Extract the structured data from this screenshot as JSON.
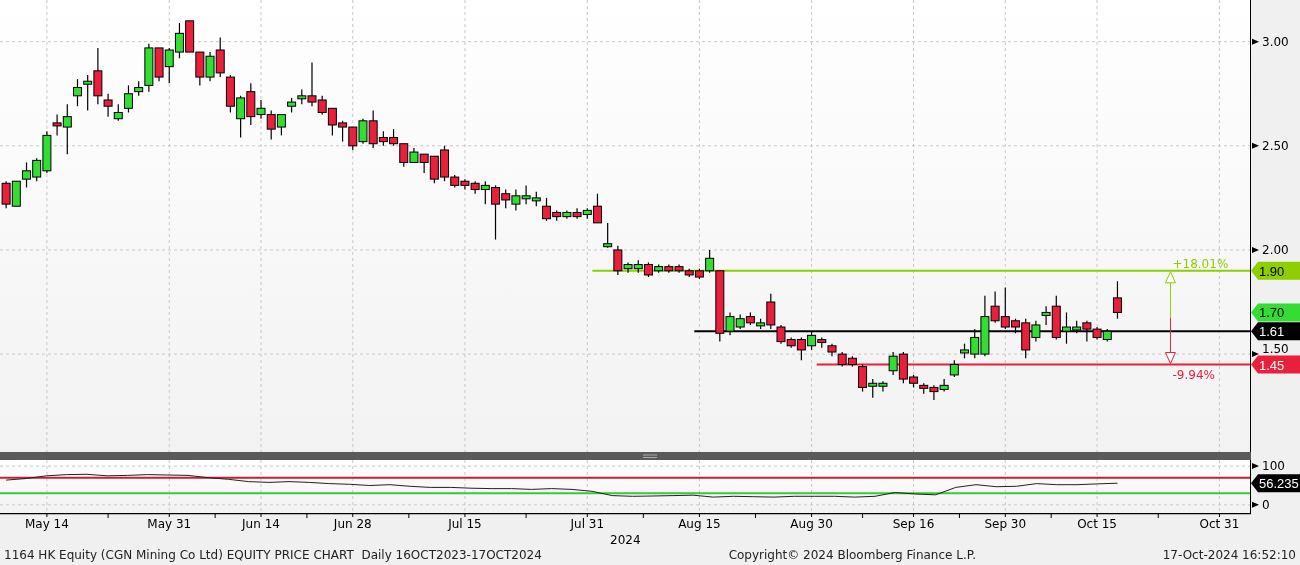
{
  "price_chart": {
    "last_price_tag": "1.70",
    "chart_data": {
      "type": "candlestick",
      "grid": true,
      "ylim": [
        1.03,
        3.2
      ],
      "yticks": [
        {
          "value": 1.5,
          "label": "1.50"
        },
        {
          "value": 2.0,
          "label": "2.00"
        },
        {
          "value": 2.5,
          "label": "2.50"
        },
        {
          "value": 3.0,
          "label": "3.00"
        }
      ],
      "categories": [
        null,
        null,
        null,
        null,
        "May 14",
        null,
        null,
        null,
        null,
        null,
        null,
        null,
        null,
        null,
        null,
        null,
        "May 31",
        null,
        null,
        null,
        null,
        null,
        null,
        null,
        null,
        "Jun 14",
        null,
        null,
        null,
        null,
        null,
        null,
        null,
        null,
        "Jun 28",
        null,
        null,
        null,
        null,
        null,
        null,
        null,
        null,
        null,
        null,
        "Jul 15",
        null,
        null,
        null,
        null,
        null,
        null,
        null,
        null,
        null,
        null,
        null,
        "Jul 31",
        null,
        null,
        null,
        null,
        null,
        null,
        null,
        null,
        null,
        null,
        "Aug 15",
        null,
        null,
        null,
        null,
        null,
        null,
        null,
        null,
        null,
        null,
        "Aug 30",
        null,
        null,
        null,
        null,
        null,
        null,
        null,
        null,
        null,
        "Sep 16",
        null,
        null,
        null,
        null,
        null,
        null,
        null,
        null,
        "Sep 30",
        null,
        null,
        null,
        null,
        null,
        null,
        null,
        null,
        "Oct 15",
        null,
        null,
        null,
        null,
        null,
        null,
        null,
        null,
        null,
        null,
        null,
        "Oct 31"
      ],
      "ohlc": [
        [
          2.32,
          2.33,
          2.2,
          2.22
        ],
        [
          2.21,
          2.33,
          2.21,
          2.33
        ],
        [
          2.34,
          2.42,
          2.3,
          2.38
        ],
        [
          2.35,
          2.44,
          2.33,
          2.43
        ],
        [
          2.38,
          2.57,
          2.37,
          2.55
        ],
        [
          2.61,
          2.65,
          2.55,
          2.6
        ],
        [
          2.59,
          2.7,
          2.46,
          2.64
        ],
        [
          2.74,
          2.82,
          2.69,
          2.78
        ],
        [
          2.8,
          2.84,
          2.67,
          2.81
        ],
        [
          2.86,
          2.97,
          2.7,
          2.74
        ],
        [
          2.72,
          2.75,
          2.64,
          2.69
        ],
        [
          2.63,
          2.7,
          2.62,
          2.66
        ],
        [
          2.68,
          2.79,
          2.66,
          2.75
        ],
        [
          2.76,
          2.81,
          2.74,
          2.78
        ],
        [
          2.79,
          2.99,
          2.76,
          2.97
        ],
        [
          2.97,
          2.97,
          2.81,
          2.83
        ],
        [
          2.88,
          2.97,
          2.8,
          2.96
        ],
        [
          2.95,
          3.09,
          2.92,
          3.04
        ],
        [
          3.1,
          3.1,
          2.95,
          2.95
        ],
        [
          2.95,
          2.95,
          2.79,
          2.83
        ],
        [
          2.83,
          2.95,
          2.81,
          2.93
        ],
        [
          2.96,
          3.02,
          2.83,
          2.85
        ],
        [
          2.83,
          2.84,
          2.66,
          2.69
        ],
        [
          2.63,
          2.74,
          2.54,
          2.73
        ],
        [
          2.76,
          2.8,
          2.6,
          2.64
        ],
        [
          2.65,
          2.72,
          2.63,
          2.68
        ],
        [
          2.65,
          2.67,
          2.53,
          2.58
        ],
        [
          2.59,
          2.65,
          2.55,
          2.65
        ],
        [
          2.69,
          2.73,
          2.66,
          2.71
        ],
        [
          2.73,
          2.77,
          2.7,
          2.74
        ],
        [
          2.74,
          2.9,
          2.69,
          2.71
        ],
        [
          2.72,
          2.74,
          2.65,
          2.66
        ],
        [
          2.68,
          2.68,
          2.55,
          2.6
        ],
        [
          2.61,
          2.62,
          2.52,
          2.59
        ],
        [
          2.59,
          2.59,
          2.48,
          2.5
        ],
        [
          2.52,
          2.63,
          2.51,
          2.62
        ],
        [
          2.62,
          2.67,
          2.49,
          2.51
        ],
        [
          2.54,
          2.57,
          2.5,
          2.52
        ],
        [
          2.54,
          2.58,
          2.5,
          2.51
        ],
        [
          2.51,
          2.51,
          2.4,
          2.42
        ],
        [
          2.42,
          2.49,
          2.42,
          2.47
        ],
        [
          2.46,
          2.46,
          2.37,
          2.42
        ],
        [
          2.45,
          2.45,
          2.32,
          2.34
        ],
        [
          2.48,
          2.5,
          2.33,
          2.35
        ],
        [
          2.35,
          2.36,
          2.3,
          2.31
        ],
        [
          2.33,
          2.34,
          2.29,
          2.31
        ],
        [
          2.32,
          2.33,
          2.27,
          2.29
        ],
        [
          2.29,
          2.33,
          2.22,
          2.31
        ],
        [
          2.3,
          2.31,
          2.05,
          2.22
        ],
        [
          2.27,
          2.29,
          2.2,
          2.24
        ],
        [
          2.22,
          2.29,
          2.19,
          2.26
        ],
        [
          2.25,
          2.31,
          2.22,
          2.26
        ],
        [
          2.24,
          2.28,
          2.21,
          2.25
        ],
        [
          2.21,
          2.25,
          2.14,
          2.15
        ],
        [
          2.18,
          2.19,
          2.14,
          2.16
        ],
        [
          2.16,
          2.19,
          2.15,
          2.18
        ],
        [
          2.18,
          2.2,
          2.15,
          2.16
        ],
        [
          2.17,
          2.2,
          2.15,
          2.19
        ],
        [
          2.21,
          2.27,
          2.13,
          2.13
        ],
        [
          2.02,
          2.13,
          2.01,
          2.03
        ],
        [
          2.0,
          2.02,
          1.88,
          1.9
        ],
        [
          1.91,
          1.94,
          1.89,
          1.93
        ],
        [
          1.91,
          1.95,
          1.89,
          1.93
        ],
        [
          1.93,
          1.94,
          1.87,
          1.88
        ],
        [
          1.9,
          1.93,
          1.89,
          1.92
        ],
        [
          1.92,
          1.93,
          1.89,
          1.9
        ],
        [
          1.92,
          1.93,
          1.89,
          1.9
        ],
        [
          1.9,
          1.91,
          1.87,
          1.88
        ],
        [
          1.9,
          1.91,
          1.86,
          1.87
        ],
        [
          1.9,
          2.0,
          1.89,
          1.96
        ],
        [
          1.9,
          1.9,
          1.56,
          1.6
        ],
        [
          1.61,
          1.7,
          1.59,
          1.68
        ],
        [
          1.63,
          1.69,
          1.62,
          1.67
        ],
        [
          1.68,
          1.7,
          1.64,
          1.65
        ],
        [
          1.64,
          1.67,
          1.62,
          1.65
        ],
        [
          1.75,
          1.79,
          1.62,
          1.64
        ],
        [
          1.63,
          1.64,
          1.55,
          1.56
        ],
        [
          1.57,
          1.58,
          1.53,
          1.54
        ],
        [
          1.57,
          1.58,
          1.47,
          1.52
        ],
        [
          1.54,
          1.61,
          1.52,
          1.59
        ],
        [
          1.57,
          1.58,
          1.53,
          1.56
        ],
        [
          1.54,
          1.55,
          1.49,
          1.51
        ],
        [
          1.5,
          1.51,
          1.44,
          1.45
        ],
        [
          1.48,
          1.49,
          1.44,
          1.45
        ],
        [
          1.44,
          1.45,
          1.32,
          1.34
        ],
        [
          1.35,
          1.38,
          1.29,
          1.36
        ],
        [
          1.35,
          1.37,
          1.32,
          1.36
        ],
        [
          1.42,
          1.51,
          1.4,
          1.49
        ],
        [
          1.5,
          1.51,
          1.36,
          1.38
        ],
        [
          1.39,
          1.4,
          1.34,
          1.36
        ],
        [
          1.35,
          1.36,
          1.31,
          1.34
        ],
        [
          1.34,
          1.35,
          1.28,
          1.32
        ],
        [
          1.33,
          1.38,
          1.32,
          1.35
        ],
        [
          1.4,
          1.47,
          1.39,
          1.45
        ],
        [
          1.51,
          1.55,
          1.48,
          1.52
        ],
        [
          1.5,
          1.62,
          1.48,
          1.58
        ],
        [
          1.5,
          1.78,
          1.49,
          1.68
        ],
        [
          1.73,
          1.8,
          1.65,
          1.66
        ],
        [
          1.68,
          1.82,
          1.62,
          1.63
        ],
        [
          1.66,
          1.67,
          1.6,
          1.63
        ],
        [
          1.65,
          1.67,
          1.48,
          1.52
        ],
        [
          1.58,
          1.66,
          1.56,
          1.64
        ],
        [
          1.69,
          1.73,
          1.64,
          1.7
        ],
        [
          1.73,
          1.78,
          1.57,
          1.58
        ],
        [
          1.61,
          1.7,
          1.55,
          1.63
        ],
        [
          1.62,
          1.66,
          1.6,
          1.63
        ],
        [
          1.65,
          1.66,
          1.56,
          1.62
        ],
        [
          1.62,
          1.63,
          1.57,
          1.58
        ],
        [
          1.57,
          1.62,
          1.56,
          1.61
        ],
        [
          1.77,
          1.85,
          1.67,
          1.7
        ],
        null,
        null,
        null,
        null,
        null,
        null,
        null,
        null,
        null,
        null
      ],
      "ref_lines": [
        {
          "axis": "y",
          "value": 1.9,
          "label": "1.90",
          "color": "#8fce00"
        },
        {
          "axis": "y",
          "value": 1.61,
          "label": "1.61",
          "color": "#000000"
        },
        {
          "axis": "y",
          "value": 1.45,
          "label": "1.45",
          "color": "#e8203c"
        }
      ],
      "annotations": [
        "+18.01%",
        "-9.94%"
      ]
    }
  },
  "indicator_chart": {
    "last_value_tag": "56.235",
    "chart_data": {
      "type": "line",
      "grid": true,
      "ylim": [
        -21,
        115.8
      ],
      "yticks": [
        0,
        100
      ],
      "categories": [
        null,
        null,
        null,
        null,
        null,
        null,
        null,
        null,
        null,
        null,
        null,
        null,
        null,
        null,
        null,
        null,
        null,
        null,
        null,
        null,
        null,
        null,
        null,
        null,
        null,
        null,
        null,
        null,
        null,
        null,
        null,
        null,
        null,
        null,
        null,
        null,
        null,
        null,
        null,
        null,
        null,
        null,
        null,
        null,
        null,
        null,
        null,
        null,
        null,
        null,
        null,
        null,
        null,
        null,
        null,
        null
      ],
      "series": [
        {
          "color": "#222222",
          "values": [
            64,
            68,
            75,
            78,
            79,
            75,
            76,
            78,
            77,
            76,
            70,
            66,
            60,
            58,
            60,
            58,
            55,
            53,
            50,
            52,
            48,
            45,
            45,
            43,
            42,
            42,
            40,
            42,
            40,
            35,
            24,
            22,
            23,
            24,
            25,
            20,
            22,
            21,
            20,
            22,
            22,
            22,
            20,
            22,
            32,
            28,
            26,
            45,
            52,
            47,
            48,
            55,
            52,
            52,
            54,
            56
          ]
        }
      ],
      "ref_lines": [
        {
          "axis": "y",
          "value": 70,
          "color": "#c8202c"
        },
        {
          "axis": "y",
          "value": 30,
          "color": "#33cc33"
        }
      ]
    }
  },
  "year_label": "2024",
  "footer": {
    "title": "1164 HK Equity (CGN Mining Co Ltd) EQUITY PRICE CHART  Daily 16OCT2023-17OCT2024",
    "copyright": "Copyright© 2024 Bloomberg Finance L.P.",
    "timestamp": "17-Oct-2024 16:52:10"
  }
}
